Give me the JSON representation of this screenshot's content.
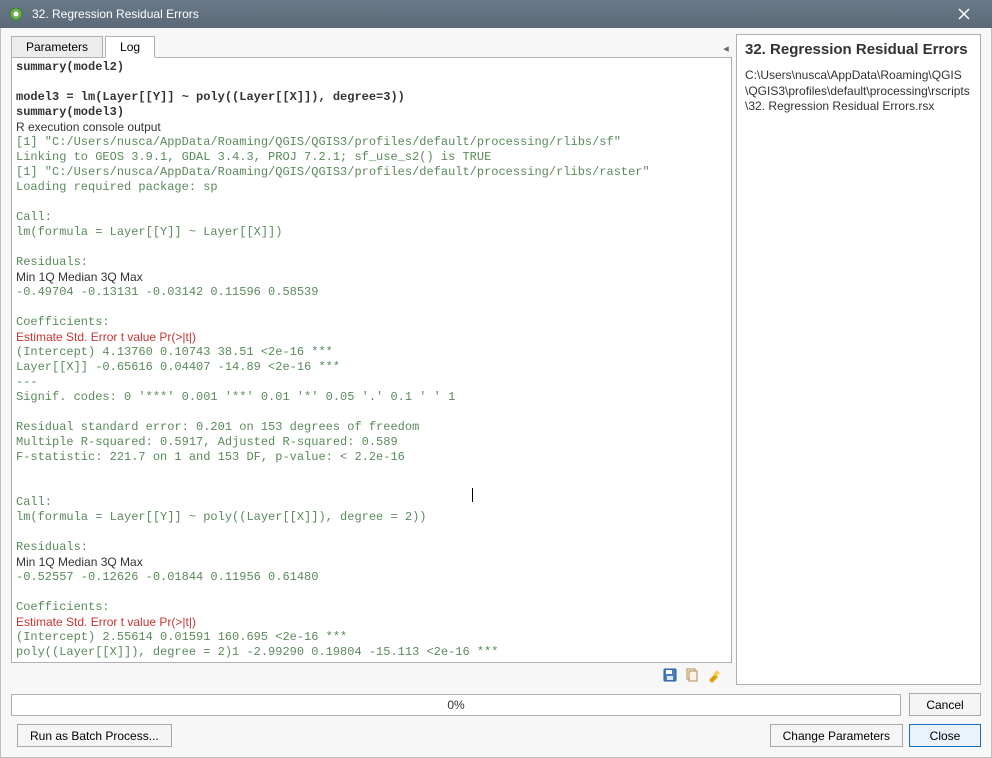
{
  "window": {
    "title": "32. Regression Residual Errors"
  },
  "tabs": {
    "parameters": "Parameters",
    "log": "Log",
    "active": "log"
  },
  "log": {
    "lines": [
      {
        "text": "summary(model2)",
        "cls": "bold"
      },
      {
        "text": ""
      },
      {
        "text": "model3 = lm(Layer[[Y]] ~ poly((Layer[[X]]), degree=3))",
        "cls": "bold"
      },
      {
        "text": "summary(model3)",
        "cls": "bold"
      },
      {
        "text": "R execution console output",
        "cls": "sans"
      },
      {
        "text": "[1] \"C:/Users/nusca/AppData/Roaming/QGIS/QGIS3/profiles/default/processing/rlibs/sf\"",
        "cls": "green"
      },
      {
        "text": "Linking to GEOS 3.9.1, GDAL 3.4.3, PROJ 7.2.1; sf_use_s2() is TRUE",
        "cls": "green"
      },
      {
        "text": "[1] \"C:/Users/nusca/AppData/Roaming/QGIS/QGIS3/profiles/default/processing/rlibs/raster\"",
        "cls": "green"
      },
      {
        "text": "Loading required package: sp",
        "cls": "green"
      },
      {
        "text": ""
      },
      {
        "text": "Call:",
        "cls": "green"
      },
      {
        "text": "lm(formula = Layer[[Y]] ~ Layer[[X]])",
        "cls": "green"
      },
      {
        "text": ""
      },
      {
        "text": "Residuals:",
        "cls": "green"
      },
      {
        "text": "Min 1Q Median 3Q Max",
        "cls": "sans"
      },
      {
        "text": "-0.49704 -0.13131 -0.03142 0.11596 0.58539",
        "cls": "green"
      },
      {
        "text": ""
      },
      {
        "text": "Coefficients:",
        "cls": "green"
      },
      {
        "text": "Estimate Std. Error t value Pr(>|t|)",
        "cls": "sans red"
      },
      {
        "text": "(Intercept) 4.13760 0.10743 38.51 <2e-16 ***",
        "cls": "green"
      },
      {
        "text": "Layer[[X]] -0.65616 0.04407 -14.89 <2e-16 ***",
        "cls": "green"
      },
      {
        "text": "---",
        "cls": "green"
      },
      {
        "text": "Signif. codes: 0 '***' 0.001 '**' 0.01 '*' 0.05 '.' 0.1 ' ' 1",
        "cls": "green"
      },
      {
        "text": ""
      },
      {
        "text": "Residual standard error: 0.201 on 153 degrees of freedom",
        "cls": "green"
      },
      {
        "text": "Multiple R-squared: 0.5917, Adjusted R-squared: 0.589",
        "cls": "green"
      },
      {
        "text": "F-statistic: 221.7 on 1 and 153 DF, p-value: < 2.2e-16",
        "cls": "green"
      },
      {
        "text": ""
      },
      {
        "text": ""
      },
      {
        "text": "Call:",
        "cls": "green"
      },
      {
        "text": "lm(formula = Layer[[Y]] ~ poly((Layer[[X]]), degree = 2))",
        "cls": "green"
      },
      {
        "text": ""
      },
      {
        "text": "Residuals:",
        "cls": "green"
      },
      {
        "text": "Min 1Q Median 3Q Max",
        "cls": "sans"
      },
      {
        "text": "-0.52557 -0.12626 -0.01844 0.11956 0.61480",
        "cls": "green"
      },
      {
        "text": ""
      },
      {
        "text": "Coefficients:",
        "cls": "green"
      },
      {
        "text": "Estimate Std. Error t value Pr(>|t|)",
        "cls": "sans red"
      },
      {
        "text": "(Intercept) 2.55614 0.01591 160.695 <2e-16 ***",
        "cls": "green"
      },
      {
        "text": "poly((Layer[[X]]), degree = 2)1 -2.99290 0.19804 -15.113 <2e-16 ***",
        "cls": "green"
      }
    ]
  },
  "side": {
    "title": "32. Regression Residual Errors",
    "path": "C:\\Users\\nusca\\AppData\\Roaming\\QGIS\\QGIS3\\profiles\\default\\processing\\rscripts\\32. Regression Residual Errors.rsx"
  },
  "progress": {
    "percent": "0%"
  },
  "buttons": {
    "cancel": "Cancel",
    "batch": "Run as Batch Process...",
    "change": "Change Parameters",
    "close": "Close"
  }
}
